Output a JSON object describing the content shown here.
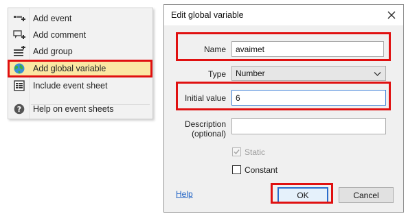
{
  "context_menu": {
    "items": [
      {
        "label": "Add event",
        "icon": "add-event-icon"
      },
      {
        "label": "Add comment",
        "icon": "add-comment-icon"
      },
      {
        "label": "Add group",
        "icon": "add-group-icon"
      },
      {
        "label": "Add global variable",
        "icon": "globe-icon",
        "highlighted": true
      },
      {
        "label": "Include event sheet",
        "icon": "event-sheet-icon"
      },
      {
        "label": "Help on event sheets",
        "icon": "help-icon"
      }
    ],
    "highlight_color": "#fbe7a3"
  },
  "dialog": {
    "title": "Edit global variable",
    "name": {
      "label": "Name",
      "value": "avaimet"
    },
    "type": {
      "label": "Type",
      "selected": "Number"
    },
    "initial_value": {
      "label": "Initial value",
      "value": "6"
    },
    "description": {
      "label_line1": "Description",
      "label_line2": "(optional)",
      "value": ""
    },
    "static": {
      "label": "Static",
      "checked": true,
      "enabled": false
    },
    "constant": {
      "label": "Constant",
      "checked": false
    },
    "help_link": "Help",
    "ok_label": "OK",
    "cancel_label": "Cancel"
  },
  "colors": {
    "annotation_red": "#e01010",
    "link_blue": "#1a5fc4",
    "focus_blue": "#3d7fd6"
  }
}
